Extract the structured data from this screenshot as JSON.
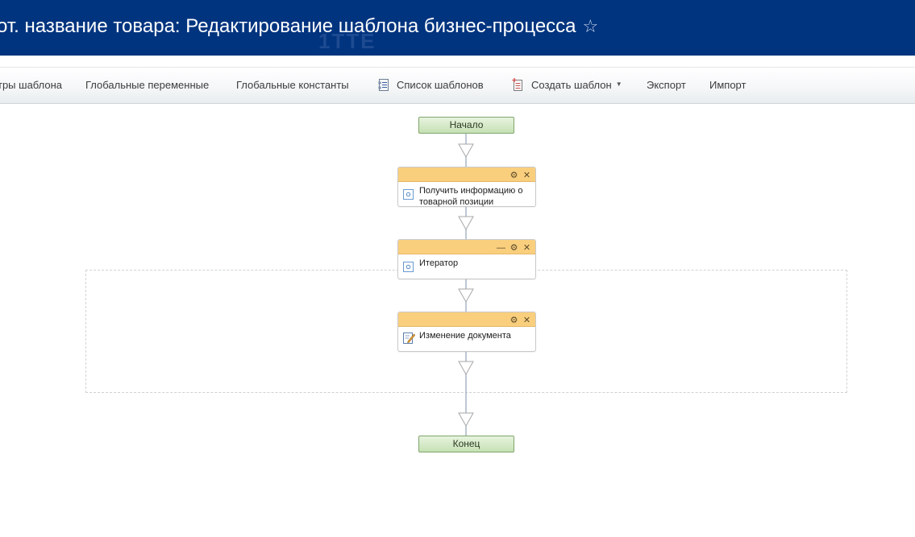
{
  "header": {
    "title": "от. название товара: Редактирование шаблона бизнес-процесса",
    "watermark": "1ТТЕ"
  },
  "toolbar": {
    "items": [
      {
        "label": "тры шаблона"
      },
      {
        "label": "Глобальные переменные"
      },
      {
        "label": "Глобальные константы"
      },
      {
        "label": "Список шаблонов",
        "icon": "template-list-icon"
      },
      {
        "label": "Создать шаблон",
        "icon": "create-template-icon",
        "dropdown": true
      },
      {
        "label": "Экспорт"
      },
      {
        "label": "Импорт"
      }
    ]
  },
  "workflow": {
    "start_label": "Начало",
    "end_label": "Конец",
    "activities": [
      {
        "label": "Получить информацию о товарной позиции",
        "icon": "activity-icon",
        "controls": [
          "settings",
          "close"
        ]
      },
      {
        "label": "Итератор",
        "icon": "activity-icon",
        "controls": [
          "collapse",
          "settings",
          "close"
        ]
      },
      {
        "label": "Изменение документа",
        "icon": "edit-document-icon",
        "controls": [
          "settings",
          "close"
        ]
      }
    ]
  },
  "colors": {
    "header_bg": "#00347f",
    "activity_header": "#f9cf7e",
    "terminal_fill": "#c6e1b5"
  }
}
